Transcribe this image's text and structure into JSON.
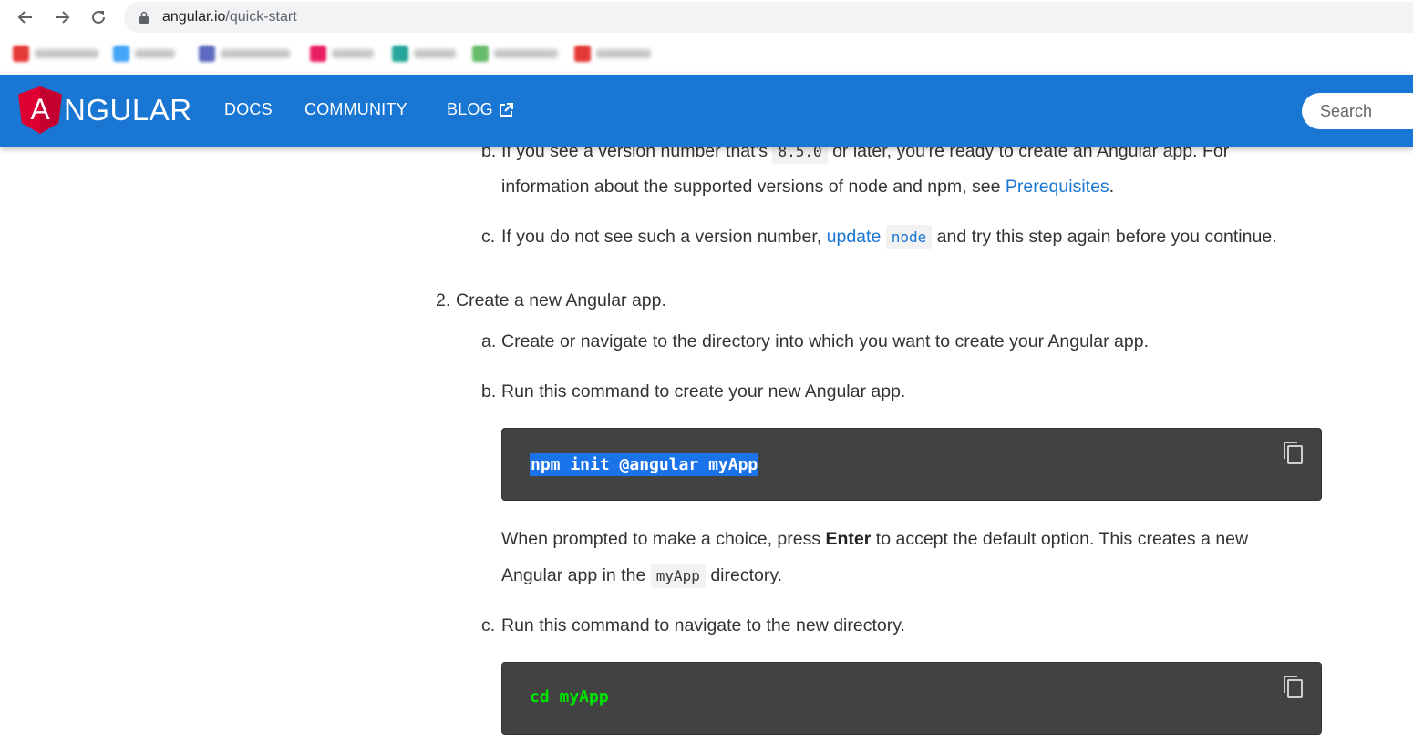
{
  "browser": {
    "url_domain": "angular.io",
    "url_path": "/quick-start",
    "nav_icons": [
      "back-arrow-icon",
      "forward-arrow-icon",
      "reload-icon",
      "lock-icon"
    ],
    "bookmark_colors": [
      "#e53935",
      "#42a5f5",
      "#5c6bc0",
      "#e91e63",
      "#26a69a",
      "#66bb6a",
      "#e53935"
    ]
  },
  "header": {
    "logo_text": "NGULAR",
    "logo_letter": "A",
    "nav": {
      "docs": "DOCS",
      "community": "COMMUNITY",
      "blog": "BLOG"
    },
    "search_placeholder": "Search",
    "colors": {
      "bar": "#1976d2",
      "shield": "#dd0031",
      "shield_dark": "#c3002f"
    }
  },
  "content": {
    "step1": {
      "b_marker": "b.",
      "b_text_1": "If you see a version number that's",
      "b_code": "8.5.0",
      "b_text_2": "or later, you're ready to create an Angular app. For",
      "b_text_3": "information about the supported versions of node and npm, see",
      "b_link": "Prerequisites",
      "b_text_4": ".",
      "c_marker": "c.",
      "c_text_1": "If you do not see such a version number,",
      "c_link": "update",
      "c_code": "node",
      "c_text_2": "and try this step again before you continue."
    },
    "step2": {
      "marker": "2.",
      "title": "Create a new Angular app.",
      "a_marker": "a.",
      "a_text": "Create or navigate to the directory into which you want to create your Angular app.",
      "b_marker": "b.",
      "b_text": "Run this command to create your new Angular app.",
      "b_command": "npm init @angular myApp",
      "prompt_text_1": "When prompted to make a choice, press",
      "prompt_key": "Enter",
      "prompt_text_2": "to accept the default option. This creates a new",
      "prompt_text_3": "Angular app in the",
      "prompt_code": "myApp",
      "prompt_text_4": "directory.",
      "c_marker": "c.",
      "c_text": "Run this command to navigate to the new directory.",
      "c_command": "cd myApp"
    }
  }
}
